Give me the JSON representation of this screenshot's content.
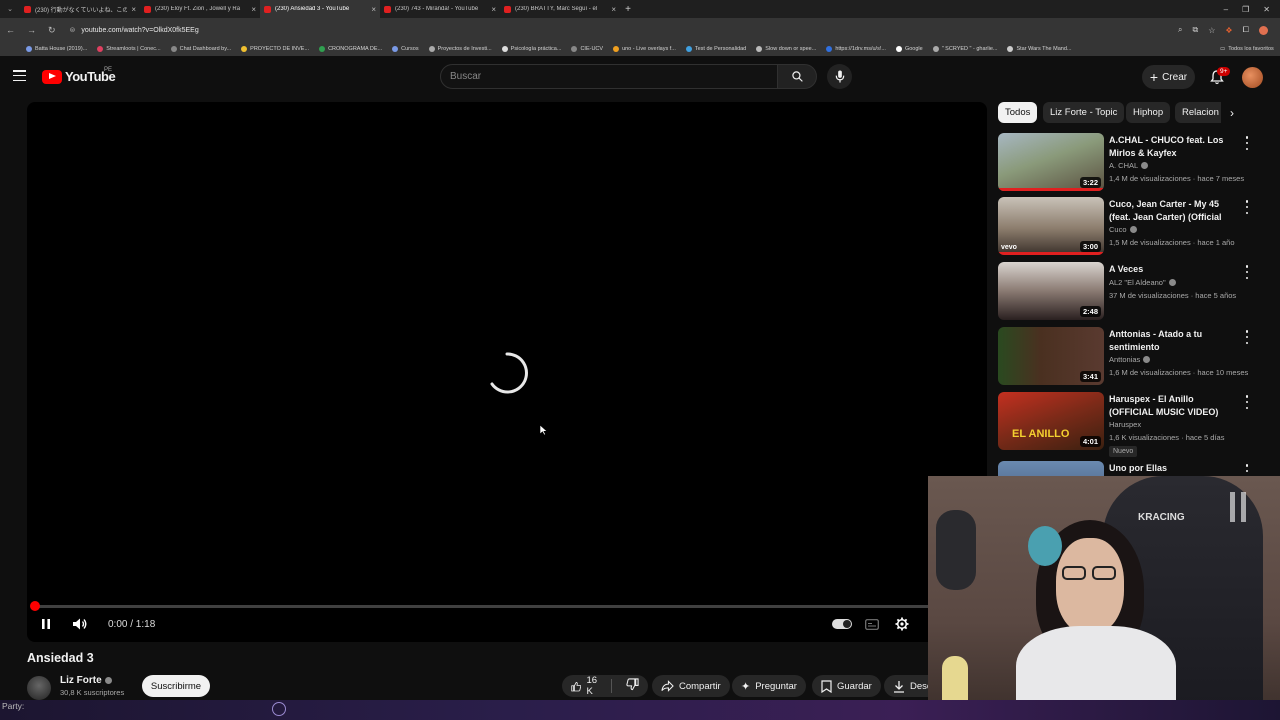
{
  "browser": {
    "tabs": [
      {
        "title": "(230) 行動がなくていいよね、この!",
        "active": false
      },
      {
        "title": "(230) Eloy Ft. Zion , Jowell y Ra",
        "active": false
      },
      {
        "title": "(230) Ansiedad 3 - YouTube",
        "active": true
      },
      {
        "title": "(230) 743 - Miranda! - YouTube",
        "active": false
      },
      {
        "title": "(230) BRATTY, Marc Seguí - el",
        "active": false
      }
    ],
    "url": "youtube.com/watch?v=OlkdX0fk5EEg",
    "bookmarks": [
      "Batta House (2019)...",
      "Streamloots | Conec...",
      "Chat Dashboard by...",
      "PROYECTO DE INVE...",
      "CRONOGRAMA DE...",
      "Cursos",
      "Proyectos de Investi...",
      "Psicología práctica...",
      "CIE-UCV",
      "uno - Live overlays f...",
      "Test de Personalidad",
      "Slow down or spee...",
      "https://1drv.ms/u/s!...",
      "Google",
      "\" SCRYED \" - gharlie...",
      "Star Wars The Mand..."
    ],
    "bookmarks_right": "Todos los favoritos"
  },
  "header": {
    "logo_text": "YouTube",
    "region": "PE",
    "search_placeholder": "Buscar",
    "create_label": "Crear",
    "notif_count": "9+"
  },
  "player": {
    "current_time": "0:00",
    "duration": "1:18",
    "time_display": "0:00 / 1:18",
    "progress": 0.0
  },
  "video": {
    "title": "Ansiedad 3",
    "channel": "Liz Forte",
    "subscribers": "30,8 K suscriptores",
    "subscribe_label": "Suscribirme",
    "likes": "16 K",
    "share_label": "Compartir",
    "ask_label": "Preguntar",
    "save_label": "Guardar",
    "download_label": "Desc"
  },
  "chips": [
    "Todos",
    "Liz Forte - Topic",
    "Hiphop",
    "Relacion"
  ],
  "recommendations": [
    {
      "title": "A.CHAL - CHUCO feat. Los Mirlos & Kayfex",
      "channel": "A. CHAL",
      "meta": "1,4 M de visualizaciones · hace 7 meses",
      "duration": "3:22",
      "color": "#7a6b55"
    },
    {
      "title": "Cuco, Jean Carter - My 45 (feat. Jean Carter) (Official Music ...",
      "channel": "Cuco",
      "meta": "1,5 M de visualizaciones · hace 1 año",
      "duration": "3:00",
      "color": "#6b5d50"
    },
    {
      "title": "A Veces",
      "channel": "AL2 \"El Aldeano\"",
      "meta": "37 M de visualizaciones · hace 5 años",
      "duration": "2:48",
      "color": "#5a4e4a"
    },
    {
      "title": "Anttonias - Atado a tu sentimiento",
      "channel": "Anttonias",
      "meta": "1,6 M de visualizaciones · hace 10 meses",
      "duration": "3:41",
      "color": "#3c2a26"
    },
    {
      "title": "Haruspex - El Anillo (OFFICIAL MUSIC VIDEO)",
      "channel": "Haruspex",
      "meta": "1,6 K visualizaciones · hace 5 días",
      "duration": "4:01",
      "color": "#7a2a20",
      "badge": "Nuevo"
    },
    {
      "title": "Uno por Ellas",
      "channel": "",
      "meta": "",
      "duration": "",
      "color": "#4c6a8a"
    }
  ],
  "statusbar": {
    "text": "Party:"
  }
}
